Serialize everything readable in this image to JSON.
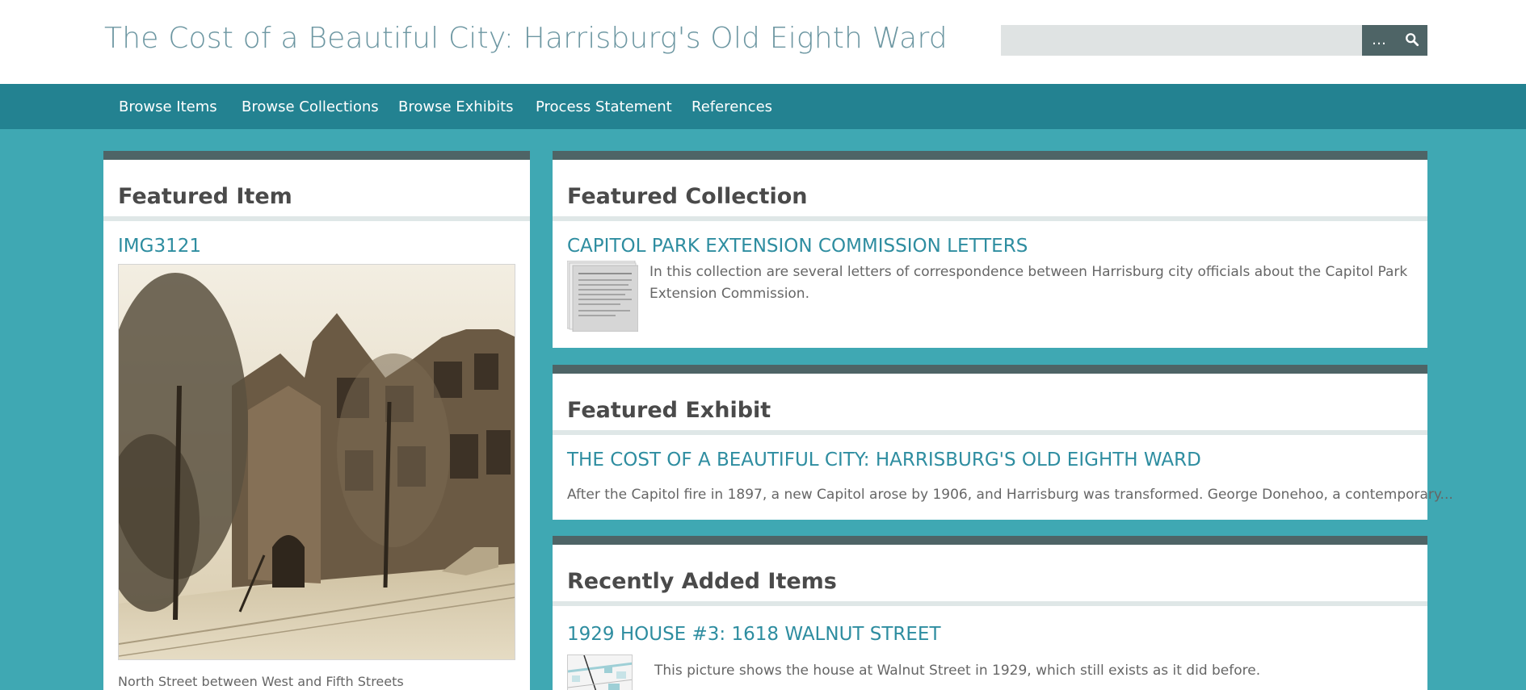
{
  "header": {
    "site_title": "The Cost of a Beautiful City: Harrisburg's Old Eighth Ward",
    "search_value": "",
    "search_advanced_label": "…",
    "search_icon": "search-icon"
  },
  "nav": {
    "items": [
      {
        "label": "Browse Items"
      },
      {
        "label": "Browse Collections"
      },
      {
        "label": "Browse Exhibits"
      },
      {
        "label": "Process Statement"
      },
      {
        "label": "References"
      }
    ]
  },
  "featured_item": {
    "heading": "Featured Item",
    "title": "IMG3121",
    "caption": "North Street between West and Fifth Streets"
  },
  "featured_collection": {
    "heading": "Featured Collection",
    "title": "CAPITOL PARK EXTENSION COMMISSION LETTERS",
    "description": "In this collection are several letters of correspondence between Harrisburg city officials about the Capitol Park Extension Commission."
  },
  "featured_exhibit": {
    "heading": "Featured Exhibit",
    "title": "THE COST OF A BEAUTIFUL CITY: HARRISBURG'S OLD EIGHTH WARD",
    "description": "After the Capitol fire in 1897, a new Capitol arose by 1906, and Harrisburg was transformed. George Donehoo, a contemporary..."
  },
  "recent_items": {
    "heading": "Recently Added Items",
    "items": [
      {
        "title": "1929 HOUSE #3: 1618 WALNUT STREET",
        "description": "This picture shows the house at Walnut Street in 1929, which still exists as it did before."
      }
    ]
  },
  "colors": {
    "page_background": "#3fa8b3",
    "nav_background": "#238291",
    "panel_header_bar": "#4e6466",
    "link": "#2e8da0",
    "site_title": "#6d97a2"
  }
}
